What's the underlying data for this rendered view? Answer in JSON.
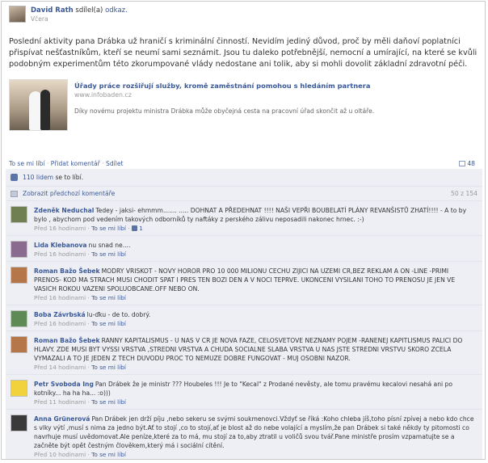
{
  "post": {
    "author": "David Rath",
    "action": "sdílel(a)",
    "object": "odkaz.",
    "time": "Včera",
    "text": "Poslední aktivity pana Drábka už hraničí s kriminální činností. Nevidím jediný důvod, proč by měli daňoví poplatníci přispívat nešťastníkům, kteří se neumí sami seznámit. Jsou tu daleko potřebnější, nemocní a umírající, na které se kvůli podobným experimentům této zkorumpované vlády nedostane ani tolik, aby si mohli dovolit základní zdravotní péči.",
    "share": {
      "title": "Úřady práce rozšiřují služby, kromě zaměstnání pomohou s hledáním partnera",
      "domain": "www.infobaden.cz",
      "description": "Díky novému projektu ministra Drábka může obyčejná cesta na pracovní úřad skončit až u oltáře."
    },
    "actions": {
      "like": "To se mi líbí",
      "comment": "Přidat komentář",
      "share": "Sdílet",
      "separator": "·"
    },
    "share_count": "48"
  },
  "ufi": {
    "likes_count": "110 lidem",
    "likes_suffix": "se to líbí.",
    "view_previous": "Zobrazit předchozí komentáře",
    "comment_count": "50 z 154"
  },
  "comments": [
    {
      "author": "Zdeněk Neduchal",
      "text": "Tedey - jaksi- ehmmm....... ..... DOHNAT A PŘEDEHNAT !!!! NAŠI VEPŘI BOUBELATÍ PLÁNY REVANŠISTŮ ZHATÍ!!!! - A to by bylo , abychom pod vedením takových odborníků ty naftáky z perského zálivu neposadili nakonec hrnec. :-)",
      "time": "Před 16 hodinami",
      "like": "To se mi líbí",
      "likes": "1",
      "avatar_color": "#6f7f52"
    },
    {
      "author": "Lida Klebanova",
      "text": "nu snad ne....",
      "time": "Před 16 hodinami",
      "like": "To se mi líbí",
      "likes": "",
      "avatar_color": "#8a6a8e"
    },
    {
      "author": "Roman Bažo Šebek",
      "text": "MODRY VRISKOT - NOVY HOROR PRO 10 000 MILIONU CECHU ZIJICI NA UZEMI CR,BEZ REKLAM A ON -LINE -PRIMI PRENOS- KOD MA STRACH MUSI CHODIT SPAT I PRES TEN BOZI DEN A V NOCI TEPRVE. UKONCENI VYSILANI TOHO TO PRENOSU JE JEN VE VASICH ROKOU VAZENI SPOLUOBCANE.OFF NEBO ON.",
      "time": "Před 16 hodinami",
      "like": "To se mi líbí",
      "likes": "",
      "avatar_color": "#b5764a"
    },
    {
      "author": "Boba Závrbská",
      "text": "lu-ďku - de to. dobrý.",
      "time": "Před 16 hodinami",
      "like": "To se mi líbí",
      "likes": "",
      "avatar_color": "#5e8a55"
    },
    {
      "author": "Roman Bažo Šebek",
      "text": "RANNY KAPITALISMUS - U NAS V CR JE NOVA FAZE, CELOSVETOVE NEZNAMY POJEM -RANENEJ KAPITLISMUS PALICI DO HLAVY. ZDE MUSI BYT VYSSI VRSTVA ,STREDNI VRSTVA A CHUDA SOCIALNE SLABA VRSTVA U NAS JSTE STREDNI VRSTVU SKORO ZCELA VYMAZALI A TO JE JEDEN Z TECH DUVODU PROC TO NEMUZE DOBRE FUNGOVAT - MUJ OSOBNI NAZOR.",
      "time": "Před 14 hodinami",
      "like": "To se mi líbí",
      "likes": "",
      "avatar_color": "#b5764a"
    },
    {
      "author": "Petr Svoboda Ing",
      "text": "Pan Drábek že je ministr ??? Houbeles !!! Je to \"Kecal\" z Prodané nevěsty, ale tomu pravému kecalovi nesahá ani po kotníky... ha ha ha... :o)))",
      "time": "Před 11 hodinami",
      "like": "To se mi líbí",
      "likes": "",
      "avatar_color": "#f2d23c"
    },
    {
      "author": "Anna Grünerová",
      "text": "Pan Drábek jen drží píju ,nebo sekeru se svými soukmenovci.Vždyť se říká :Koho chleba jíš,toho písní zpívej a nebo kdo chce s vlky výtí ,musí s nima za jedno být.Ať to stojí ,co to stojí,ať je blost až do nebe volající a myslím,že pan Drábek si také někdy ty pitomosti co navrhuje musí uvědomovat.Ale peníze,které za to má, mu stojí za to,aby ztratil u voličů svou tvář.Pane ministře prosím vzpamatujte se a začněte být opět čestným člověkem,který má i sociální cítění.",
      "time": "Před 10 hodinami",
      "like": "To se mi líbí",
      "likes": "",
      "avatar_color": "#3a3a3a"
    }
  ]
}
